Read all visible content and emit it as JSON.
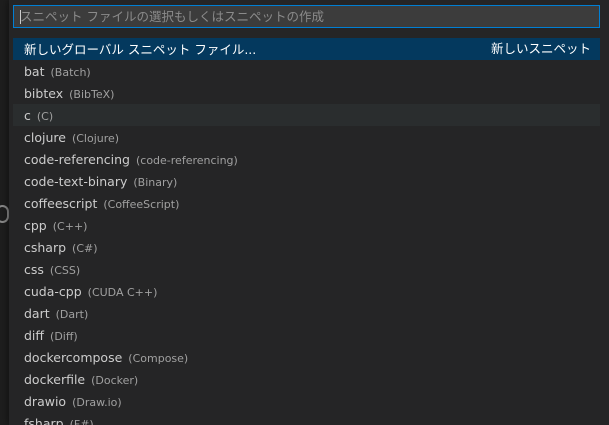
{
  "filter": {
    "placeholder": "スニペット ファイルの選択もしくはスニペットの作成",
    "value": ""
  },
  "header_item": {
    "label": "新しいグローバル スニペット ファイル...",
    "action": "新しいスニペット"
  },
  "languages": [
    {
      "label": "bat",
      "desc": "(Batch)"
    },
    {
      "label": "bibtex",
      "desc": "(BibTeX)"
    },
    {
      "label": "c",
      "desc": "(C)"
    },
    {
      "label": "clojure",
      "desc": "(Clojure)"
    },
    {
      "label": "code-referencing",
      "desc": "(code-referencing)"
    },
    {
      "label": "code-text-binary",
      "desc": "(Binary)"
    },
    {
      "label": "coffeescript",
      "desc": "(CoffeeScript)"
    },
    {
      "label": "cpp",
      "desc": "(C++)"
    },
    {
      "label": "csharp",
      "desc": "(C#)"
    },
    {
      "label": "css",
      "desc": "(CSS)"
    },
    {
      "label": "cuda-cpp",
      "desc": "(CUDA C++)"
    },
    {
      "label": "dart",
      "desc": "(Dart)"
    },
    {
      "label": "diff",
      "desc": "(Diff)"
    },
    {
      "label": "dockercompose",
      "desc": "(Compose)"
    },
    {
      "label": "dockerfile",
      "desc": "(Docker)"
    },
    {
      "label": "drawio",
      "desc": "(Draw.io)"
    },
    {
      "label": "fsharp",
      "desc": "(F#)"
    }
  ],
  "colors": {
    "accent": "#007fd4",
    "selected_row": "#04395e",
    "hover_row": "#2a2d2e",
    "panel": "#252526"
  }
}
